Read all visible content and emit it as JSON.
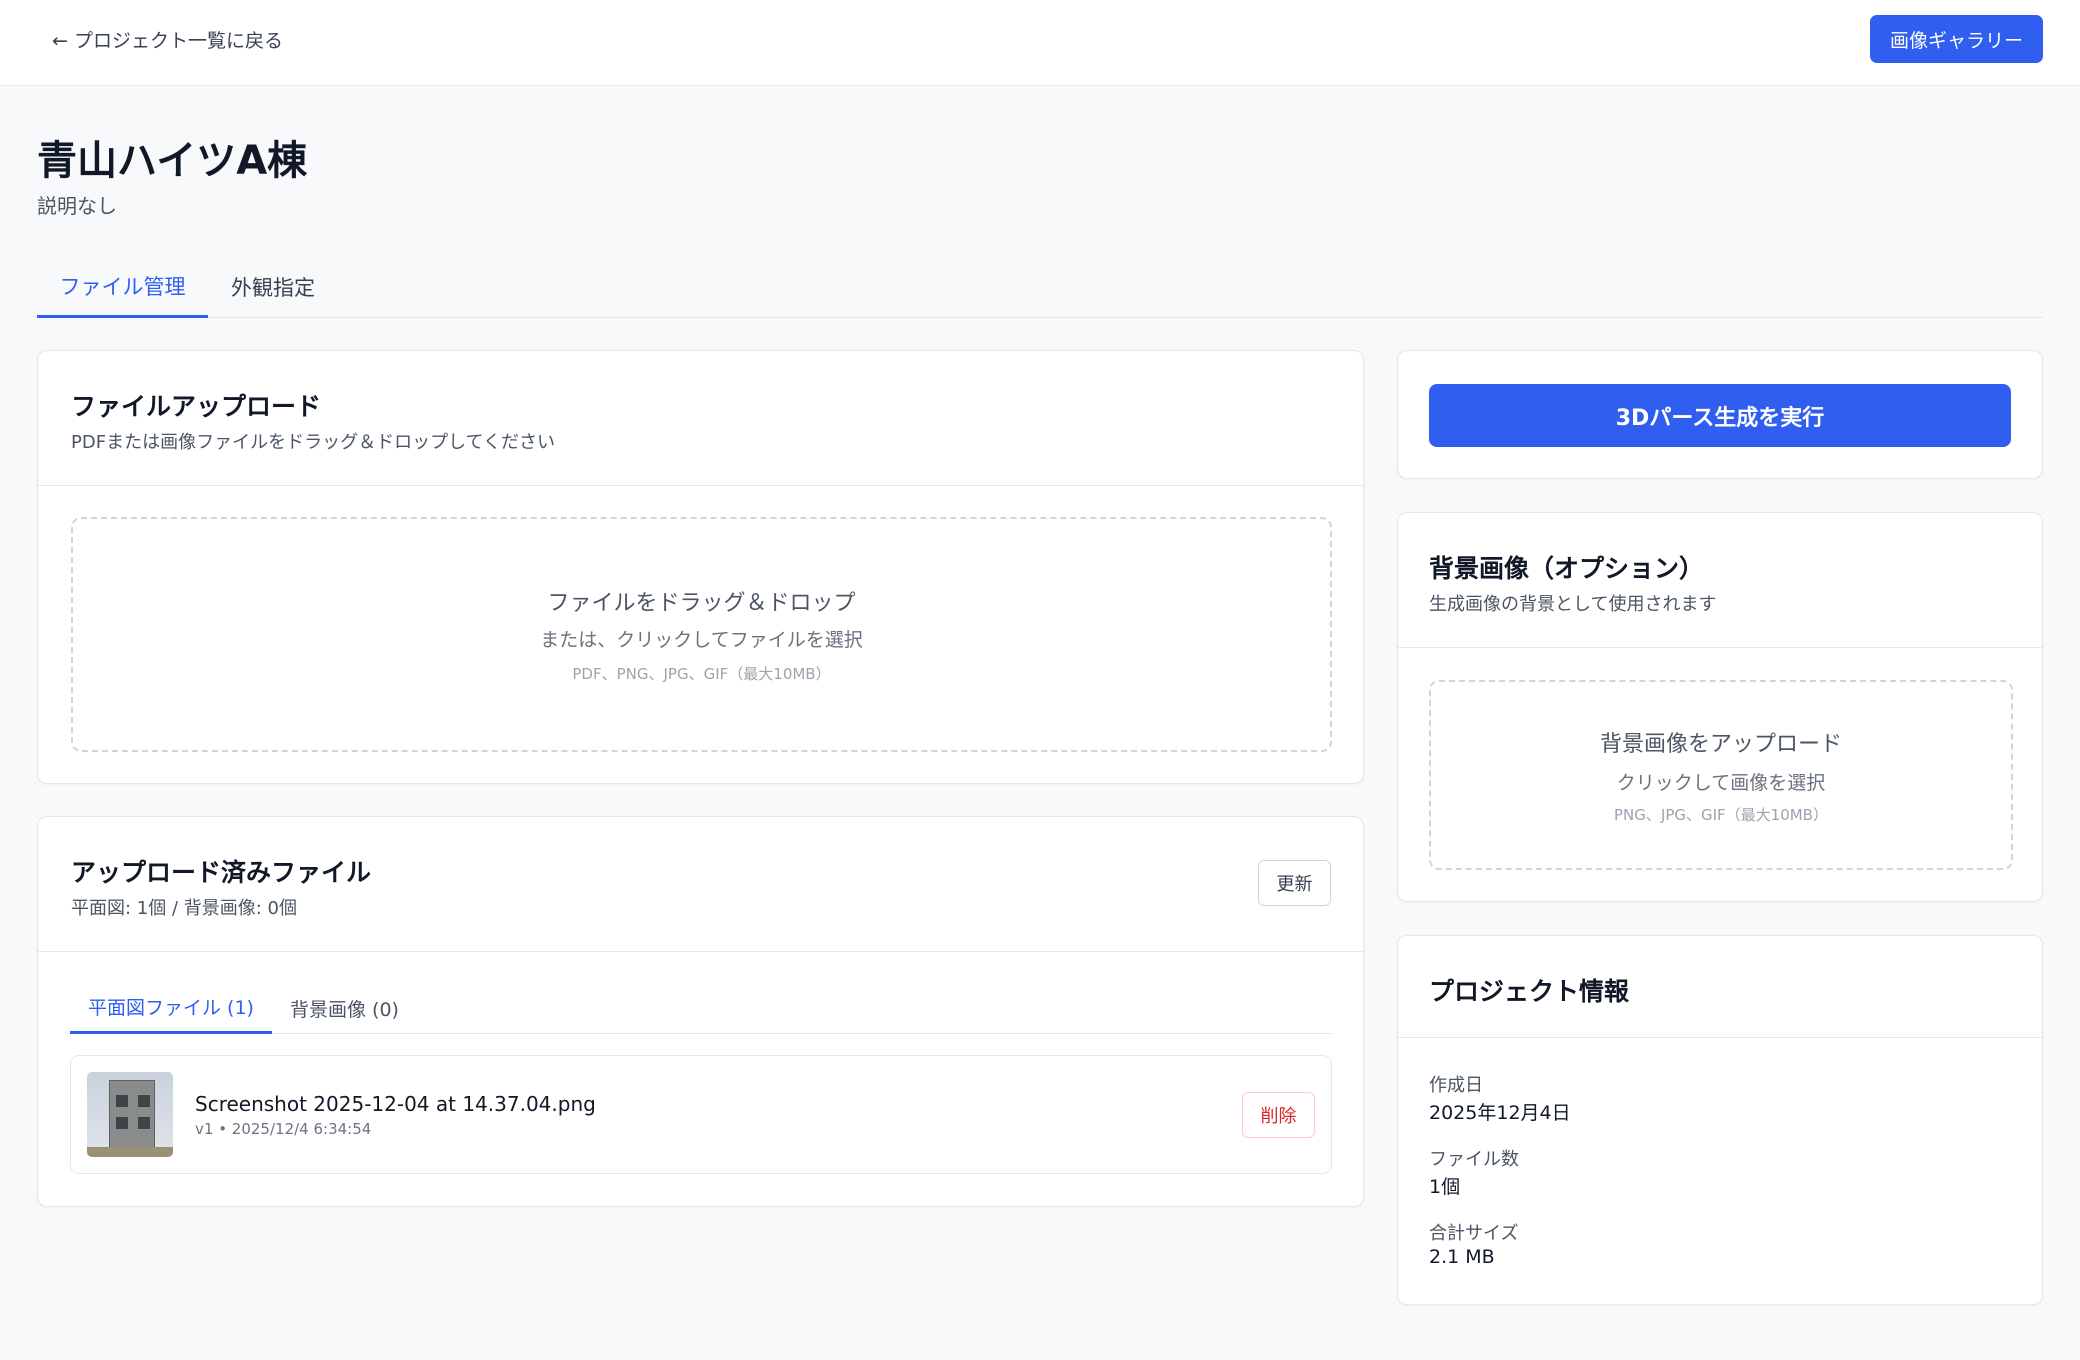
{
  "header": {
    "back_label": "← プロジェクト一覧に戻る",
    "gallery_button": "画像ギャラリー"
  },
  "project": {
    "title": "青山ハイツA棟",
    "description": "説明なし"
  },
  "main_tabs": [
    {
      "label": "ファイル管理",
      "active": true
    },
    {
      "label": "外観指定",
      "active": false
    }
  ],
  "upload_card": {
    "title": "ファイルアップロード",
    "subtitle": "PDFまたは画像ファイルをドラッグ＆ドロップしてください",
    "drop_main": "ファイルをドラッグ＆ドロップ",
    "drop_sub": "または、クリックしてファイルを選択",
    "drop_hint": "PDF、PNG、JPG、GIF（最大10MB）"
  },
  "uploaded_card": {
    "title": "アップロード済みファイル",
    "subtitle": "平面図: 1個 / 背景画像: 0個",
    "refresh_button": "更新",
    "tabs": [
      {
        "label": "平面図ファイル (1)",
        "active": true
      },
      {
        "label": "背景画像 (0)",
        "active": false
      }
    ],
    "files": [
      {
        "name": "Screenshot 2025-12-04 at 14.37.04.png",
        "meta": "v1 • 2025/12/4 6:34:54",
        "delete_label": "削除"
      }
    ]
  },
  "generate_button": "3Dパース生成を実行",
  "background_card": {
    "title": "背景画像（オプション）",
    "subtitle": "生成画像の背景として使用されます",
    "drop_main": "背景画像をアップロード",
    "drop_sub": "クリックして画像を選択",
    "drop_hint": "PNG、JPG、GIF（最大10MB）"
  },
  "info_card": {
    "title": "プロジェクト情報",
    "items": [
      {
        "label": "作成日",
        "value": "2025年12月4日"
      },
      {
        "label": "ファイル数",
        "value": "1個"
      },
      {
        "label": "合計サイズ",
        "value": "2.1 MB"
      }
    ]
  },
  "colors": {
    "accent": "#2f5ef0",
    "danger": "#dc2626",
    "background": "#f8f9fb"
  }
}
